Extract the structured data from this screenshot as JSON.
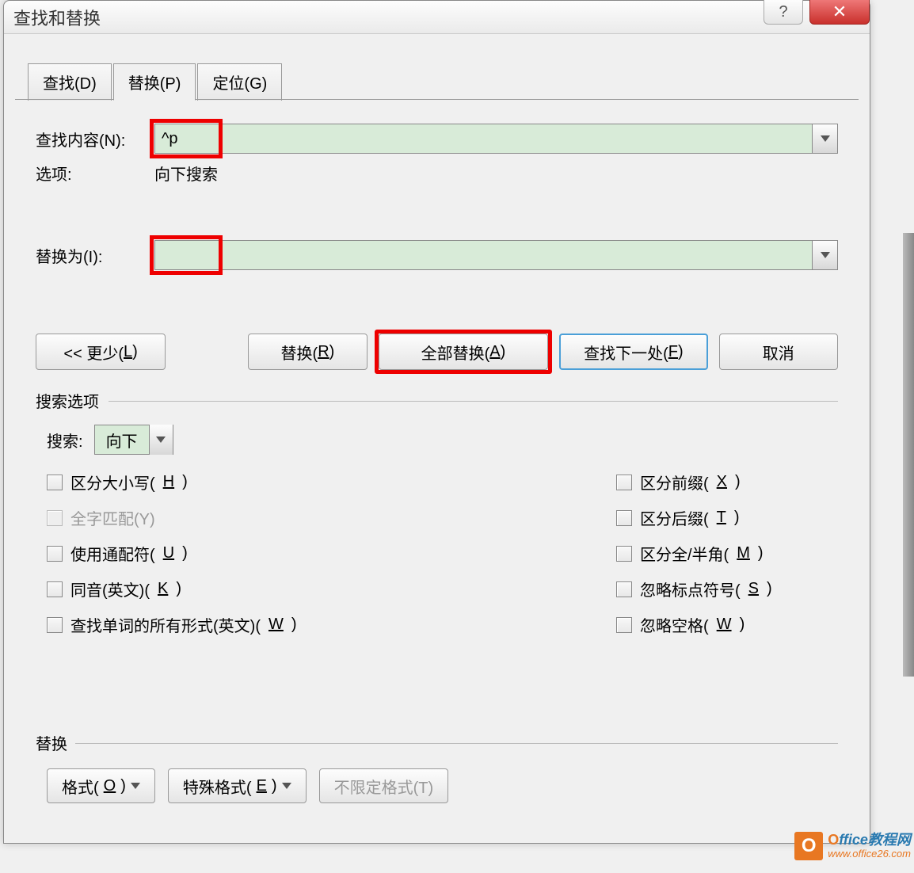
{
  "titlebar": {
    "title": "查找和替换"
  },
  "tabs": {
    "find": "查找(D)",
    "replace": "替换(P)",
    "goto": "定位(G)"
  },
  "fields": {
    "find_label": "查找内容(N):",
    "find_value": "^p",
    "options_label": "选项:",
    "options_value": "向下搜索",
    "replace_label": "替换为(I):",
    "replace_value": ""
  },
  "buttons": {
    "less": "<< 更少(L)",
    "replace": "替换(R)",
    "replace_all": "全部替换(A)",
    "find_next": "查找下一处(F)",
    "cancel": "取消"
  },
  "search_options": {
    "title": "搜索选项",
    "dir_label": "搜索:",
    "dir_value": "向下"
  },
  "checkboxes_left": {
    "case": "区分大小写(H)",
    "whole": "全字匹配(Y)",
    "wildcard": "使用通配符(U)",
    "sounds": "同音(英文)(K)",
    "forms": "查找单词的所有形式(英文)(W)"
  },
  "checkboxes_right": {
    "prefix": "区分前缀(X)",
    "suffix": "区分后缀(T)",
    "fullhalf": "区分全/半角(M)",
    "punct": "忽略标点符号(S)",
    "space": "忽略空格(W)"
  },
  "replace_section": {
    "title": "替换",
    "format": "格式(O)",
    "special": "特殊格式(E)",
    "nofmt": "不限定格式(T)"
  },
  "watermark": {
    "brand_o": "O",
    "brand_rest": "ffice教程网",
    "url": "www.office26.com"
  }
}
